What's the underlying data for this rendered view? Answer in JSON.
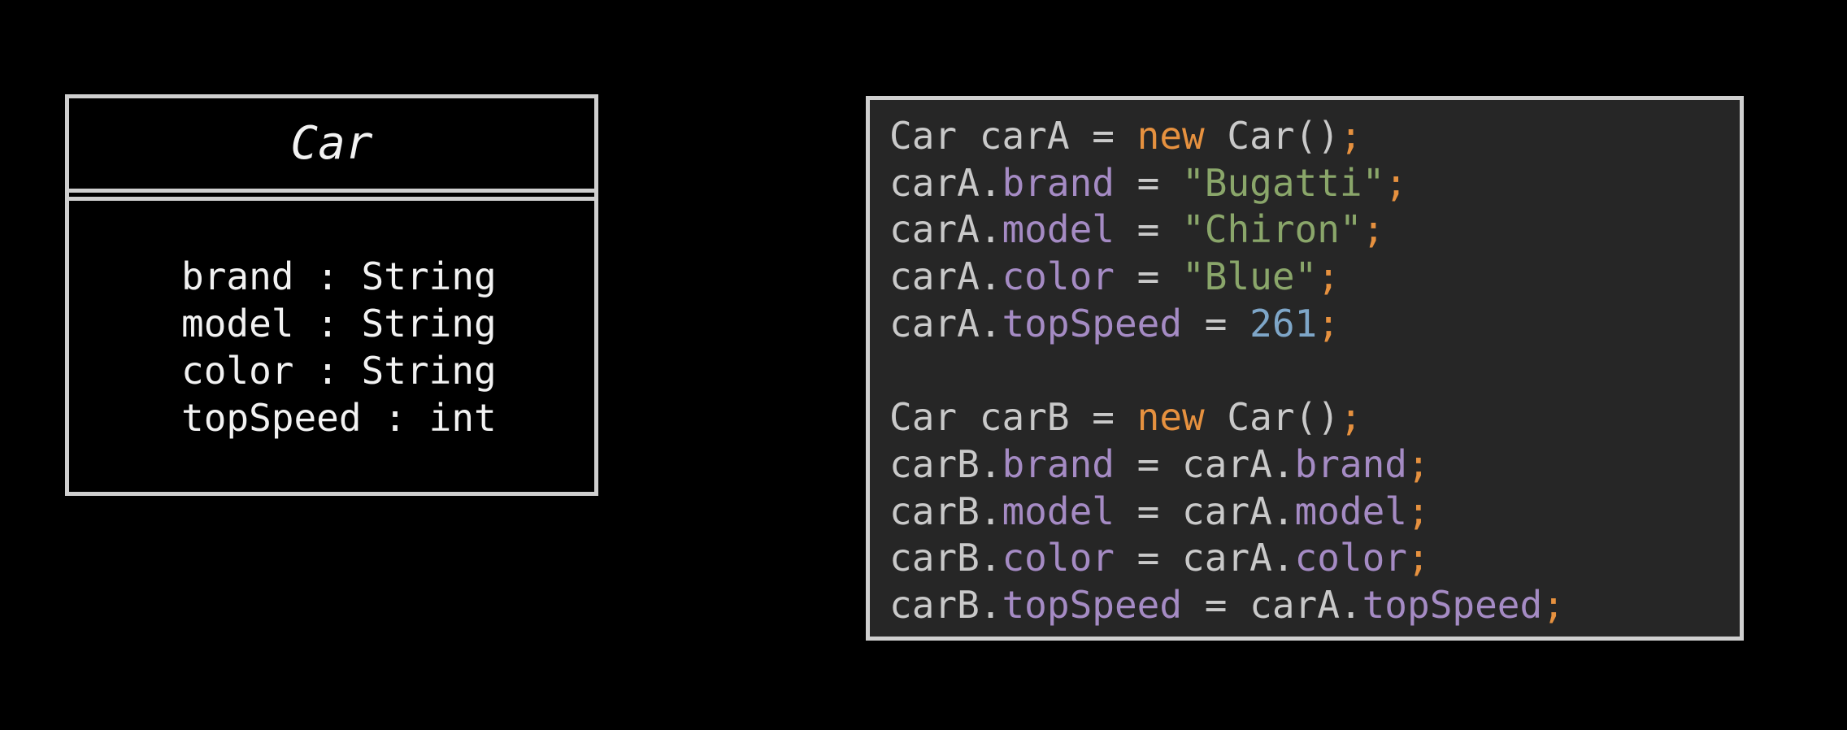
{
  "uml_class": {
    "name": "Car",
    "attributes": [
      "brand : String",
      "model : String",
      "color : String",
      "topSpeed : int"
    ]
  },
  "code": {
    "lines": [
      [
        [
          "plain",
          "Car carA = "
        ],
        [
          "kw",
          "new"
        ],
        [
          "plain",
          " Car()"
        ],
        [
          "punct",
          ";"
        ]
      ],
      [
        [
          "plain",
          "carA."
        ],
        [
          "field",
          "brand"
        ],
        [
          "plain",
          " = "
        ],
        [
          "str",
          "\"Bugatti\""
        ],
        [
          "punct",
          ";"
        ]
      ],
      [
        [
          "plain",
          "carA."
        ],
        [
          "field",
          "model"
        ],
        [
          "plain",
          " = "
        ],
        [
          "str",
          "\"Chiron\""
        ],
        [
          "punct",
          ";"
        ]
      ],
      [
        [
          "plain",
          "carA."
        ],
        [
          "field",
          "color"
        ],
        [
          "plain",
          " = "
        ],
        [
          "str",
          "\"Blue\""
        ],
        [
          "punct",
          ";"
        ]
      ],
      [
        [
          "plain",
          "carA."
        ],
        [
          "field",
          "topSpeed"
        ],
        [
          "plain",
          " = "
        ],
        [
          "num",
          "261"
        ],
        [
          "punct",
          ";"
        ]
      ],
      [],
      [
        [
          "plain",
          "Car carB = "
        ],
        [
          "kw",
          "new"
        ],
        [
          "plain",
          " Car()"
        ],
        [
          "punct",
          ";"
        ]
      ],
      [
        [
          "plain",
          "carB."
        ],
        [
          "field",
          "brand"
        ],
        [
          "plain",
          " = carA."
        ],
        [
          "field",
          "brand"
        ],
        [
          "punct",
          ";"
        ]
      ],
      [
        [
          "plain",
          "carB."
        ],
        [
          "field",
          "model"
        ],
        [
          "plain",
          " = carA."
        ],
        [
          "field",
          "model"
        ],
        [
          "punct",
          ";"
        ]
      ],
      [
        [
          "plain",
          "carB."
        ],
        [
          "field",
          "color"
        ],
        [
          "plain",
          " = carA."
        ],
        [
          "field",
          "color"
        ],
        [
          "punct",
          ";"
        ]
      ],
      [
        [
          "plain",
          "carB."
        ],
        [
          "field",
          "topSpeed"
        ],
        [
          "plain",
          " = carA."
        ],
        [
          "field",
          "topSpeed"
        ],
        [
          "punct",
          ";"
        ]
      ]
    ]
  },
  "colors": {
    "background": "#000000",
    "code_background": "#262626",
    "border": "#cfcfcf",
    "keyword": "#e6913f",
    "field": "#a58bc4",
    "string": "#8aa66a",
    "number": "#7ea6c8",
    "plain": "#c9c9c9"
  }
}
